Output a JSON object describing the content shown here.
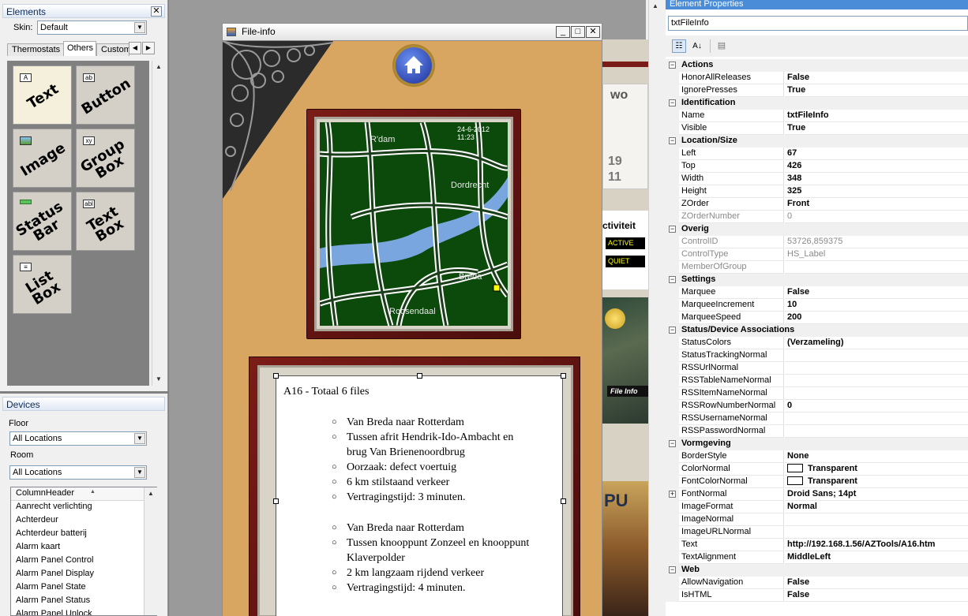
{
  "elements_panel": {
    "title": "Elements",
    "skin_label": "Skin:",
    "skin_value": "Default",
    "tabs": [
      "Thermostats",
      "Others",
      "Custom"
    ],
    "tiles": [
      "Text",
      "Button",
      "Image",
      "Group Box",
      "Status Bar",
      "Text Box",
      "List Box"
    ]
  },
  "devices_panel": {
    "title": "Devices",
    "floor_label": "Floor",
    "floor_value": "All Locations",
    "room_label": "Room",
    "room_value": "All Locations",
    "list_header": "ColumnHeader",
    "items": [
      "Aanrecht verlichting",
      "Achterdeur",
      "Achterdeur batterij",
      "Alarm kaart",
      "Alarm Panel Control",
      "Alarm Panel Display",
      "Alarm Panel State",
      "Alarm Panel Status",
      "Alarm Panel Unlock"
    ]
  },
  "window": {
    "title": "File-info",
    "map": {
      "date": "24-6-2012",
      "time": "11:23",
      "places": [
        "R'dam",
        "Dordrecht",
        "Breda",
        "Roosendaal"
      ]
    },
    "doc": {
      "heading": "A16 - Totaal 6 files",
      "group1": [
        "Van Breda naar Rotterdam",
        "Tussen afrit Hendrik-Ido-Ambacht en brug Van Brienenoordbrug",
        "Oorzaak: defect voertuig",
        "6 km stilstaand verkeer",
        "Vertragingstijd: 3 minuten."
      ],
      "group2": [
        "Van Breda naar Rotterdam",
        "Tussen knooppunt  Zonzeel en knooppunt  Klaverpolder",
        "2 km langzaam rijdend verkeer",
        "Vertragingstijd: 4 minuten."
      ]
    }
  },
  "background": {
    "wo": "wo",
    "n19": "19",
    "n11": "11",
    "activiteit": "ctiviteit",
    "active": "ACTIVE",
    "quiet": "QUIET",
    "fileinfo": "File Info",
    "pu": "PU"
  },
  "properties": {
    "title": "Element Properties",
    "object_name": "txtFileInfo",
    "rows": [
      {
        "cat": "Actions"
      },
      {
        "name": "HonorAllReleases",
        "value": "False"
      },
      {
        "name": "IgnorePresses",
        "value": "True"
      },
      {
        "cat": "Identification"
      },
      {
        "name": "Name",
        "value": "txtFileInfo"
      },
      {
        "name": "Visible",
        "value": "True"
      },
      {
        "cat": "Location/Size"
      },
      {
        "name": "Left",
        "value": "67"
      },
      {
        "name": "Top",
        "value": "426"
      },
      {
        "name": "Width",
        "value": "348"
      },
      {
        "name": "Height",
        "value": "325"
      },
      {
        "name": "ZOrder",
        "value": "Front"
      },
      {
        "name": "ZOrderNumber",
        "value": "0",
        "dim": true
      },
      {
        "cat": "Overig"
      },
      {
        "name": "ControlID",
        "value": "53726,859375",
        "dim": true
      },
      {
        "name": "ControlType",
        "value": "HS_Label",
        "dim": true
      },
      {
        "name": "MemberOfGroup",
        "value": "",
        "dim": true
      },
      {
        "cat": "Settings"
      },
      {
        "name": "Marquee",
        "value": "False"
      },
      {
        "name": "MarqueeIncrement",
        "value": "10"
      },
      {
        "name": "MarqueeSpeed",
        "value": "200"
      },
      {
        "cat": "Status/Device Associations"
      },
      {
        "name": "StatusColors",
        "value": "(Verzameling)"
      },
      {
        "name": "StatusTrackingNormal",
        "value": ""
      },
      {
        "name": "RSSUrlNormal",
        "value": ""
      },
      {
        "name": "RSSTableNameNormal",
        "value": ""
      },
      {
        "name": "RSSItemNameNormal",
        "value": ""
      },
      {
        "name": "RSSRowNumberNormal",
        "value": "0"
      },
      {
        "name": "RSSUsernameNormal",
        "value": ""
      },
      {
        "name": "RSSPasswordNormal",
        "value": ""
      },
      {
        "cat": "Vormgeving"
      },
      {
        "name": "BorderStyle",
        "value": "None"
      },
      {
        "name": "ColorNormal",
        "value": "Transparent",
        "swatch": true
      },
      {
        "name": "FontColorNormal",
        "value": "Transparent",
        "swatch": true
      },
      {
        "name": "FontNormal",
        "value": "Droid Sans; 14pt",
        "expand": true
      },
      {
        "name": "ImageFormat",
        "value": "Normal"
      },
      {
        "name": "ImageNormal",
        "value": ""
      },
      {
        "name": "ImageURLNormal",
        "value": ""
      },
      {
        "name": "Text",
        "value": "http://192.168.1.56/AZTools/A16.htm"
      },
      {
        "name": "TextAlignment",
        "value": "MiddleLeft"
      },
      {
        "cat": "Web"
      },
      {
        "name": "AllowNavigation",
        "value": "False"
      },
      {
        "name": "IsHTML",
        "value": "False"
      }
    ]
  }
}
